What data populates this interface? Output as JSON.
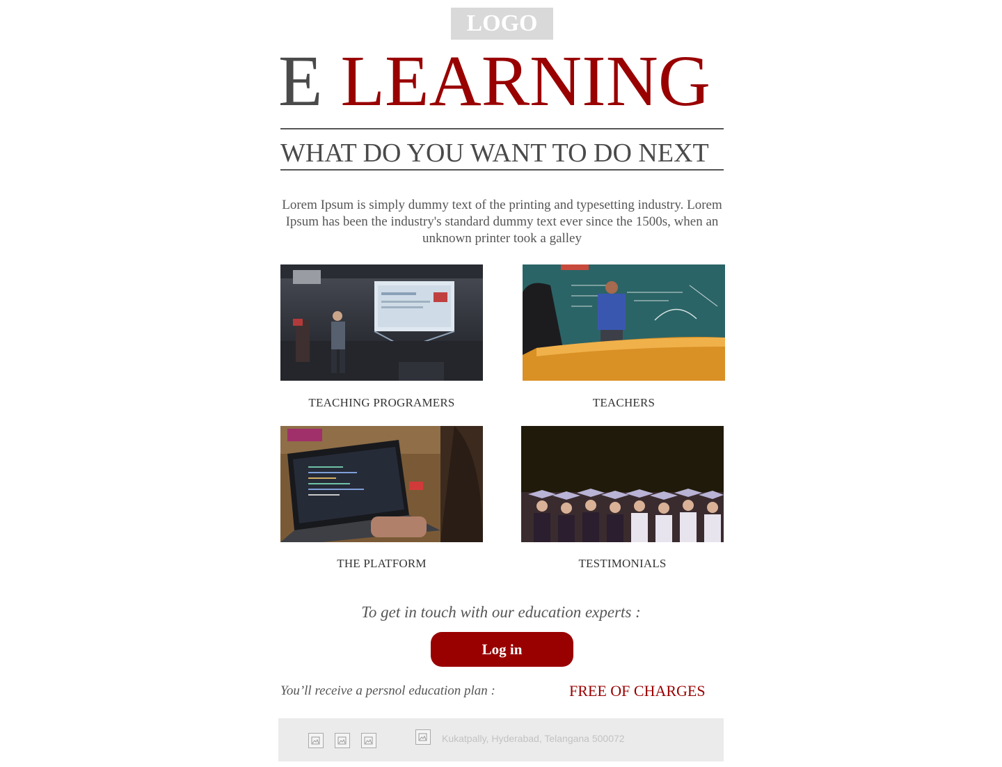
{
  "header": {
    "logo_text": "LOGO",
    "title_part1": "E",
    "title_part2": "LEARNING",
    "subtitle": "WHAT DO YOU WANT TO DO NEXT"
  },
  "intro": {
    "text": "Lorem Ipsum is simply dummy text of the printing and typesetting industry. Lorem Ipsum has been the industry's standard dummy text ever since the 1500s, when an unknown printer took a galley"
  },
  "cards": [
    {
      "label": "TEACHING PROGRAMERS",
      "image": "classroom-projector-photo"
    },
    {
      "label": "TEACHERS",
      "image": "teacher-chalkboard-photo"
    },
    {
      "label": "THE PLATFORM",
      "image": "laptop-coding-photo"
    },
    {
      "label": "TESTIMONIALS",
      "image": "graduation-crowd-photo"
    }
  ],
  "contact": {
    "text": "To get in touch with our education experts :",
    "login_label": "Log in",
    "plan_text": "You’ll receive a persnol education plan :",
    "free_text": "FREE OF CHARGES"
  },
  "footer": {
    "social_icons": [
      "broken-image-icon",
      "broken-image-icon",
      "broken-image-icon"
    ],
    "location_icon": "broken-image-icon",
    "address": "Kukatpally, Hyderabad, Telangana 500072"
  },
  "colors": {
    "brand_red": "#990000",
    "heading_gray": "#4a4a4a",
    "logo_bg": "#d9d9d9",
    "footer_bg": "#ebebeb"
  }
}
